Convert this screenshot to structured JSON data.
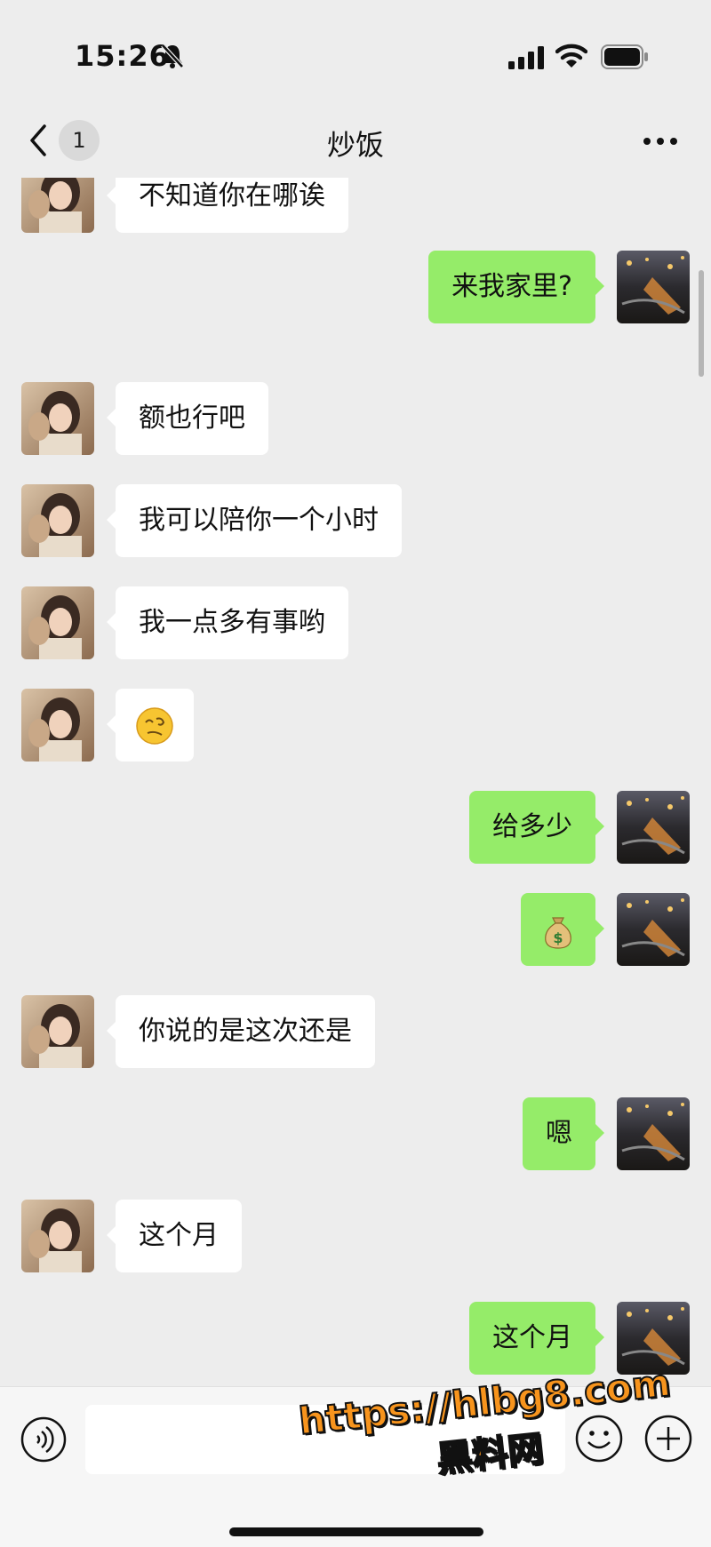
{
  "status_bar": {
    "time": "15:26",
    "icons": [
      "bell-slash-icon",
      "signal-icon",
      "wifi-icon",
      "battery-icon"
    ]
  },
  "nav": {
    "unread_count": "1",
    "title": "炒饭",
    "icons": [
      "back-icon",
      "more-icon"
    ]
  },
  "colors": {
    "background": "#ededed",
    "incoming_bubble": "#ffffff",
    "outgoing_bubble": "#95ec69",
    "watermark": "#f7941d"
  },
  "messages": [
    {
      "side": "left",
      "text": "不知道你在哪诶"
    },
    {
      "side": "right",
      "text": "来我家里?"
    },
    {
      "side": "left",
      "text": "额也行吧"
    },
    {
      "side": "left",
      "text": "我可以陪你一个小时"
    },
    {
      "side": "left",
      "text": "我一点多有事哟"
    },
    {
      "side": "left",
      "emoji": "dizzy-face-emoji"
    },
    {
      "side": "right",
      "text": "给多少"
    },
    {
      "side": "right",
      "emoji": "money-bag-emoji"
    },
    {
      "side": "left",
      "text": "你说的是这次还是"
    },
    {
      "side": "right",
      "text": "嗯"
    },
    {
      "side": "left",
      "text": "这个月"
    },
    {
      "side": "right",
      "text": "这个月"
    }
  ],
  "input_bar": {
    "placeholder": "",
    "icons": [
      "voice-icon",
      "emoji-icon",
      "plus-icon"
    ]
  },
  "watermark": {
    "url": "https://hlbg8.com",
    "name": "黑料网"
  }
}
